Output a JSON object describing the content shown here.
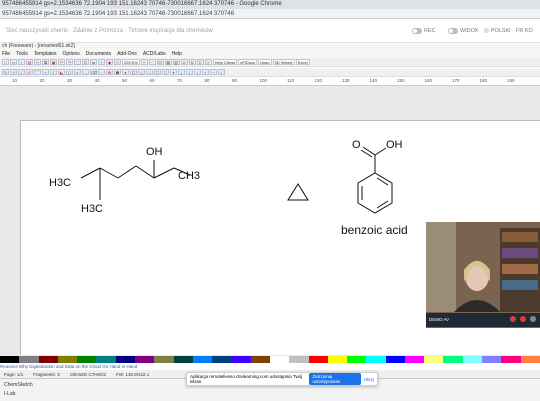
{
  "browser": {
    "title": "957486455914 gs=2.1534636 72.1904 193 151.16243 70746-730016667.1624 370746 - Google Chrome",
    "address": "957486455914 gs=2.1534636 72.1904 193 151.16243 70746-730016667.1624 370746"
  },
  "site": {
    "breadcrumb": "Sieć nauczycieli chemii · Zdalnie z Pomorza · Tirtowe inspiracje dla chemików",
    "nav": [
      "REC",
      "WIDOK",
      "POLSKI",
      "FR KO"
    ]
  },
  "app": {
    "window_title": "ch (Freeware) - [renamed01.sk2]",
    "menu": [
      "File",
      "Tools",
      "Templates",
      "Options",
      "Documents",
      "Add-Ons",
      "ACD/Labs",
      "Help"
    ],
    "zoom": "220.5%",
    "toolbar_labels": [
      "Help Chess",
      "eFiDocs",
      "Undo",
      "3D Viewer",
      "Excel"
    ],
    "tooltip": "Cross/Hatching (Select) Bonds",
    "ruler_ticks": [
      "10",
      "20",
      "30",
      "40",
      "50",
      "60",
      "70",
      "80",
      "90",
      "100",
      "110",
      "120",
      "130",
      "140",
      "150",
      "160",
      "170",
      "180",
      "190"
    ]
  },
  "drawing": {
    "mol1": {
      "ch3_left": "H3C",
      "ch3_bottom": "H3C",
      "oh": "OH",
      "ch3_right": "CH3"
    },
    "benzoic": {
      "o": "O",
      "oh": "OH",
      "label": "benzoic acid"
    }
  },
  "palette_colors": [
    "#000000",
    "#808080",
    "#800000",
    "#808000",
    "#008000",
    "#008080",
    "#000080",
    "#800080",
    "#808040",
    "#004040",
    "#0080ff",
    "#004080",
    "#4000ff",
    "#804000",
    "#ffffff",
    "#c0c0c0",
    "#ff0000",
    "#ffff00",
    "#00ff00",
    "#00ffff",
    "#0000ff",
    "#ff00ff",
    "#ffff80",
    "#00ff80",
    "#80ffff",
    "#8080ff",
    "#ff0080",
    "#ff8040"
  ],
  "news": "Reasons Why Digitalization and Data on the Cloud Go Hand in Hand",
  "statusbar": {
    "page": "Page: 1/1",
    "frags": "Fragments: 3",
    "formula": "C8H18O C7H6O2",
    "fw": "FW: 130.9/122.1"
  },
  "share": {
    "text": "Aplikacja remoteliveso.ctivlearning.com udostępnia Twój ekran.",
    "stop": "Zatrzymaj udostępnianie",
    "hide": "Ukryj"
  },
  "video": {
    "name": "DEMO AV"
  },
  "taskbar": {
    "item1": "ChemSketch",
    "item2": "I-Lab"
  }
}
